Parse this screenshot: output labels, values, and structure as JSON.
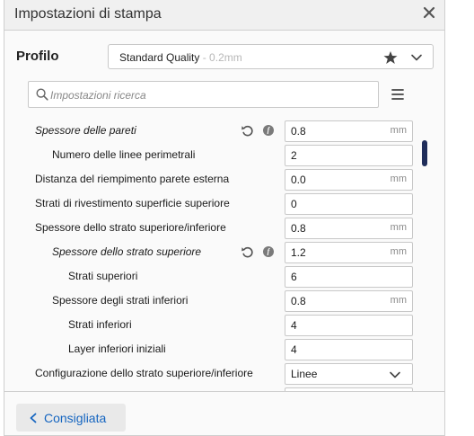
{
  "window": {
    "title": "Impostazioni di stampa"
  },
  "profile": {
    "label": "Profilo",
    "selected_name": "Standard Quality",
    "selected_sub": " - 0.2mm"
  },
  "search": {
    "placeholder": "Impostazioni ricerca"
  },
  "settings": [
    {
      "label": "Spessore delle pareti",
      "value": "0.8",
      "unit": "mm"
    },
    {
      "label": "Numero delle linee perimetrali",
      "value": "2",
      "unit": ""
    },
    {
      "label": "Distanza del riempimento parete esterna",
      "value": "0.0",
      "unit": "mm"
    },
    {
      "label": "Strati di rivestimento superficie superiore",
      "value": "0",
      "unit": ""
    },
    {
      "label": "Spessore dello strato superiore/inferiore",
      "value": "0.8",
      "unit": "mm"
    },
    {
      "label": "Spessore dello strato superiore",
      "value": "1.2",
      "unit": "mm"
    },
    {
      "label": "Strati superiori",
      "value": "6",
      "unit": ""
    },
    {
      "label": "Spessore degli strati inferiori",
      "value": "0.8",
      "unit": "mm"
    },
    {
      "label": "Strati inferiori",
      "value": "4",
      "unit": ""
    },
    {
      "label": "Layer inferiori iniziali",
      "value": "4",
      "unit": ""
    },
    {
      "label": "Configurazione dello strato superiore/inferiore",
      "value": "Linee",
      "unit": ""
    }
  ],
  "footer": {
    "back_label": "Consigliata"
  },
  "colors": {
    "accent": "#1565c0",
    "scrollbar": "#1f2d5a"
  },
  "icons": [
    "close-icon",
    "star-icon",
    "chevron-down-icon",
    "search-icon",
    "menu-icon",
    "reset-icon",
    "function-icon",
    "chevron-left-icon"
  ]
}
